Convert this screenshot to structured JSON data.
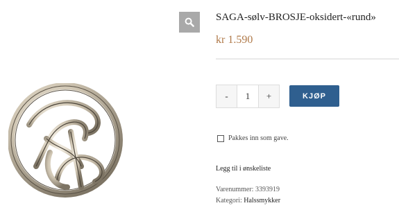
{
  "product": {
    "title": "SAGA-sølv-BROSJE-oksidert-«rund»",
    "price": "kr 1.590"
  },
  "cart": {
    "minus_label": "-",
    "quantity": "1",
    "plus_label": "+",
    "buy_label": "KJØP"
  },
  "options": {
    "gift_wrap_label": "Pakkes inn som gave."
  },
  "wishlist": {
    "label": "Legg til i ønskeliste"
  },
  "meta": {
    "sku_label": "Varenummer:",
    "sku_value": "3393919",
    "category_label": "Kategori:",
    "category_value": "Halssmykker"
  },
  "icons": {
    "zoom": "search-icon"
  },
  "colors": {
    "price": "#b07a4a",
    "buy_button": "#2f5f8f",
    "zoom_button": "#a9a9a9"
  }
}
